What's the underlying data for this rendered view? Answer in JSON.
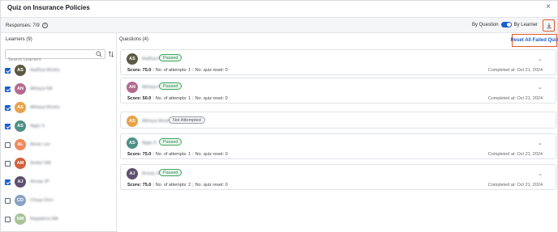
{
  "modal": {
    "title": "Quiz on Insurance Policies",
    "close_icon": "×"
  },
  "responses": {
    "label": "Responses: 7/9",
    "info_icon": "i",
    "toggle_left": "By Question",
    "toggle_right": "By Learner",
    "toggle_on": true
  },
  "learners": {
    "heading": "Learners",
    "count": "(9)",
    "search_placeholder": "Search Learners",
    "items": [
      {
        "initials": "AS",
        "name": "Aadhya Mootry",
        "color": "#5b5b45",
        "checked": true
      },
      {
        "initials": "AN",
        "name": "Abhaya NA",
        "color": "#b36a8e",
        "checked": true
      },
      {
        "initials": "AS",
        "name": "Abhaya Mootry",
        "color": "#e8a24a",
        "checked": true
      },
      {
        "initials": "AS",
        "name": "Aggu S",
        "color": "#4f8f86",
        "checked": true
      },
      {
        "initials": "AL",
        "name": "Alean Lee",
        "color": "#f08a5d",
        "checked": false
      },
      {
        "initials": "AM",
        "name": "Amber MA",
        "color": "#d1603d",
        "checked": false
      },
      {
        "initials": "AJ",
        "name": "Anoop JP",
        "color": "#5d5070",
        "checked": true
      },
      {
        "initials": "CD",
        "name": "Chopy Devi",
        "color": "#8aa3c2",
        "checked": false
      },
      {
        "initials": "NM",
        "name": "Nagadeva MA",
        "color": "#a8c49a",
        "checked": false
      }
    ]
  },
  "questions": {
    "heading": "Questions",
    "count": "(4)",
    "reset_label": "Reset All Failed Quiz",
    "cards": [
      {
        "initials": "AS",
        "name": "Aadhya Mootry",
        "color": "#5b5b45",
        "status": "Passed",
        "status_type": "passed",
        "has_details": true,
        "score": "Score: 75.0",
        "attempts": "No. of attempts: 1",
        "reset": "No. quiz reset: 0",
        "completed": "Completed at: Oct 21, 2024"
      },
      {
        "initials": "AN",
        "name": "Abhaya NA",
        "color": "#b36a8e",
        "status": "Passed",
        "status_type": "passed",
        "has_details": true,
        "score": "Score: 50.0",
        "attempts": "No. of attempts: 1",
        "reset": "No. quiz reset: 0",
        "completed": "Completed at: Oct 21, 2024"
      },
      {
        "initials": "AS",
        "name": "Abhaya Mootry",
        "color": "#e8a24a",
        "status": "Not Attempted",
        "status_type": "notattempted",
        "has_details": false
      },
      {
        "initials": "AS",
        "name": "Aggu S",
        "color": "#4f8f86",
        "status": "Passed",
        "status_type": "passed",
        "has_details": true,
        "score": "Score: 75.0",
        "attempts": "No. of attempts: 1",
        "reset": "No. quiz reset: 0",
        "completed": "Completed at: Oct 21, 2024"
      },
      {
        "initials": "AJ",
        "name": "Anoop JP",
        "color": "#5d5070",
        "status": "Passed",
        "status_type": "passed",
        "has_details": true,
        "score": "Score: 75.0",
        "attempts": "No. of attempts: 2",
        "reset": "No. quiz reset: 0",
        "completed": "Completed at: Oct 21, 2024"
      }
    ]
  }
}
